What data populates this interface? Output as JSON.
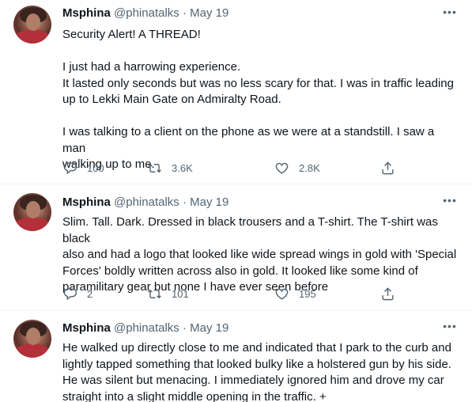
{
  "tweets": [
    {
      "name": "Msphina",
      "handle": "@phinatalks",
      "separator": "·",
      "date": "May 19",
      "text": "Security Alert! A THREAD!\n\nI just had a harrowing experience.\nIt lasted only seconds but was no less scary for that. I was in traffic leading\nup to Lekki Main Gate on Admiralty Road.\n\nI was talking to a client on the phone as we were at a standstill. I saw a man\nwalking up to me.",
      "replies": "100",
      "retweets": "3.6K",
      "likes": "2.8K"
    },
    {
      "name": "Msphina",
      "handle": "@phinatalks",
      "separator": "·",
      "date": "May 19",
      "text": "Slim. Tall. Dark. Dressed in black trousers and a T-shirt. The T-shirt was black\nalso and had a logo that looked like wide spread wings in gold with 'Special\nForces' boldly written across also in gold. It looked like some kind of\nparamilitary gear but none I have ever seen before",
      "replies": "2",
      "retweets": "101",
      "likes": "195"
    },
    {
      "name": "Msphina",
      "handle": "@phinatalks",
      "separator": "·",
      "date": "May 19",
      "text": "He walked up directly close to me and indicated that I park to the curb and\nlightly tapped something that looked bulky like a holstered gun by his side.\nHe was silent but menacing. I immediately ignored him and drove my car\nstraight into a slight middle opening in the traffic. +"
    }
  ],
  "icons": {
    "more": "more-horizontal-icon",
    "reply": "reply-icon",
    "retweet": "retweet-icon",
    "like": "heart-icon",
    "share": "share-icon"
  },
  "colors": {
    "secondary_text": "#536471",
    "primary_text": "#0f1419",
    "divider": "#eff3f4"
  }
}
